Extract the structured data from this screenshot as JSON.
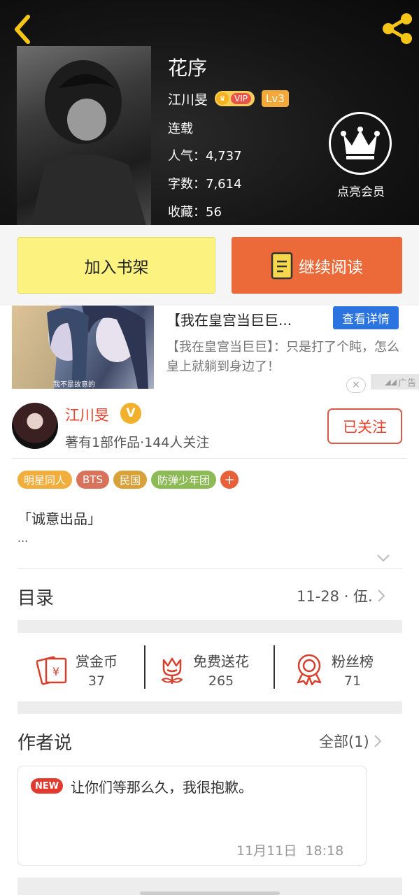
{
  "header": {
    "book_title": "花序",
    "author": "江川旻",
    "vip_label": "VIP",
    "level": "Lv3",
    "status": "连载",
    "popularity": "人气：4,737",
    "word_count": "字数：7,614",
    "favorites": "收藏：56",
    "member_label": "点亮会员"
  },
  "actions": {
    "add_shelf": "加入书架",
    "continue_read": "继续阅读"
  },
  "ad": {
    "title": "【我在皇宫当巨巨...",
    "detail_button": "查看详情",
    "description": "【我在皇宫当巨巨】：只是打了个盹，怎么皇上就躺到身边了！",
    "image_caption": "我不是故意的",
    "ad_tag": "广告"
  },
  "author": {
    "name": "江川旻",
    "verified": "V",
    "stats": "著有1部作品·144人关注",
    "follow_label": "已关注"
  },
  "tags": [
    {
      "label": "明星同人",
      "color": "#f2ae3c"
    },
    {
      "label": "BTS",
      "color": "#d9725a"
    },
    {
      "label": "民国",
      "color": "#d9a13a"
    },
    {
      "label": "防弹少年团",
      "color": "#8cba55"
    }
  ],
  "tag_more": "+",
  "intro": {
    "text": "「诚意出品」",
    "more": "..."
  },
  "toc": {
    "title": "目录",
    "latest": "11-28 · 伍."
  },
  "stats": [
    {
      "label": "赏金币",
      "value": "37",
      "icon": "reward-coin-icon"
    },
    {
      "label": "免费送花",
      "value": "265",
      "icon": "flower-icon"
    },
    {
      "label": "粉丝榜",
      "value": "71",
      "icon": "ribbon-medal-icon"
    }
  ],
  "author_says": {
    "title": "作者说",
    "all_label": "全部(1)",
    "new_badge": "NEW",
    "message": "让你们等那么久，我很抱歉。",
    "time": "11月11日  18:18"
  },
  "colors": {
    "accent_orange": "#ec6a3a",
    "shelf_yellow": "#fbf27f",
    "icon_yellow": "#f5c518",
    "author_red": "#e8432e",
    "ad_blue": "#2a73e0"
  }
}
